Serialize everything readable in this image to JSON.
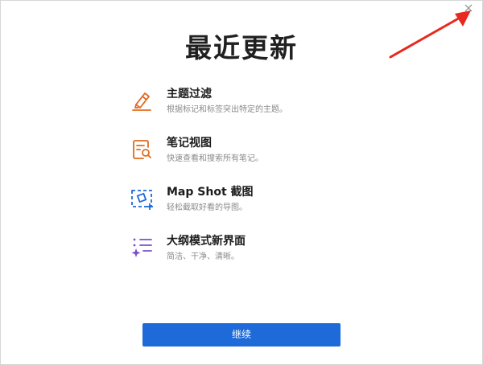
{
  "dialog": {
    "title": "最近更新",
    "close_icon": "close-icon",
    "continue_label": "继续"
  },
  "features": [
    {
      "icon": "highlighter-icon",
      "color": "#e26a1f",
      "title": "主题过滤",
      "desc": "根据标记和标签突出特定的主题。"
    },
    {
      "icon": "note-search-icon",
      "color": "#e26a1f",
      "title": "笔记视图",
      "desc": "快速查看和搜索所有笔记。"
    },
    {
      "icon": "screenshot-icon",
      "color": "#1e6ad8",
      "title": "Map Shot 截图",
      "desc": "轻松截取好看的导图。"
    },
    {
      "icon": "outline-sparkle-icon",
      "color": "#7b4fc9",
      "title": "大纲模式新界面",
      "desc": "简洁、干净、清晰。"
    }
  ],
  "colors": {
    "accent": "#1e6ad8",
    "arrow": "#e8281e"
  }
}
